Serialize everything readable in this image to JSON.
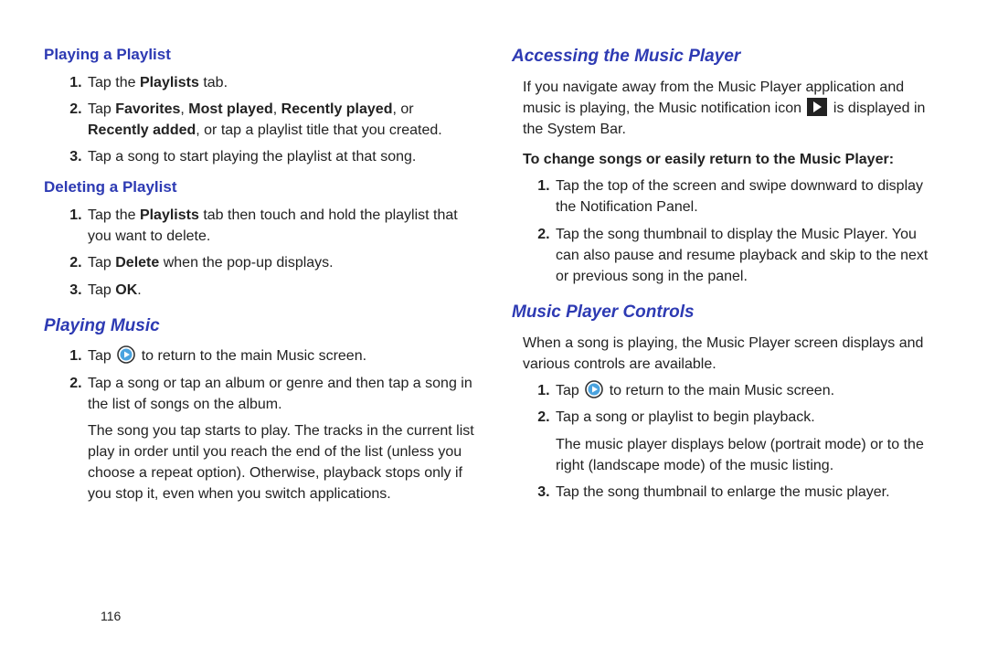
{
  "page_number": "116",
  "left": {
    "sec1_title": "Playing a Playlist",
    "sec1_li1_a": "Tap the ",
    "sec1_li1_b": "Playlists",
    "sec1_li1_c": " tab.",
    "sec1_li2_a": "Tap ",
    "sec1_li2_b": "Favorites",
    "sec1_li2_c": ", ",
    "sec1_li2_d": "Most played",
    "sec1_li2_e": ", ",
    "sec1_li2_f": "Recently played",
    "sec1_li2_g": ", or ",
    "sec1_li2_h": "Recently added",
    "sec1_li2_i": ", or tap a playlist title that you created.",
    "sec1_li3": "Tap a song to start playing the playlist at that song.",
    "sec2_title": "Deleting a Playlist",
    "sec2_li1_a": "Tap the ",
    "sec2_li1_b": "Playlists",
    "sec2_li1_c": " tab then touch and hold the playlist that you want to delete.",
    "sec2_li2_a": "Tap ",
    "sec2_li2_b": "Delete",
    "sec2_li2_c": " when the pop-up displays.",
    "sec2_li3_a": "Tap ",
    "sec2_li3_b": "OK",
    "sec2_li3_c": ".",
    "sec3_title": "Playing Music",
    "sec3_li1_a": "Tap ",
    "sec3_li1_b": " to return to the main Music screen.",
    "sec3_li2": "Tap a song or tap an album or genre and then tap a song in the list of songs on the album.",
    "sec3_p": "The song you tap starts to play. The tracks in the current list play in order until you reach the end of the list (unless you choose a repeat option). Otherwise, playback stops only if you stop it, even when you switch applications."
  },
  "right": {
    "sec1_title": "Accessing the Music Player",
    "sec1_p_a": "If you navigate away from the Music Player application and music is playing, the Music notification icon ",
    "sec1_p_b": " is displayed in the System Bar.",
    "sec1_sub": "To change songs or easily return to the Music Player:",
    "sec1_li1": "Tap the top of the screen and swipe downward to display the Notification Panel.",
    "sec1_li2": "Tap the song thumbnail to display the Music Player. You can also pause and resume playback and skip to the next or previous song in the panel.",
    "sec2_title": "Music Player Controls",
    "sec2_p": "When a song is playing, the Music Player screen displays and various controls are available.",
    "sec2_li1_a": "Tap ",
    "sec2_li1_b": " to return to the main Music screen.",
    "sec2_li2": "Tap a song or playlist to begin playback.",
    "sec2_p2": "The music player displays below (portrait mode) or to the right (landscape mode) of the music listing.",
    "sec2_li3": "Tap the song thumbnail to enlarge the music player."
  }
}
